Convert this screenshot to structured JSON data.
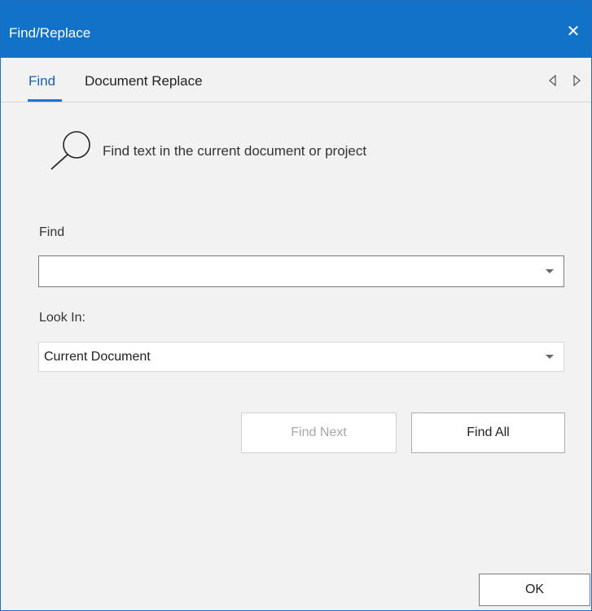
{
  "window": {
    "title": "Find/Replace",
    "close_glyph": "✕",
    "title_bar_color": "#1272c8"
  },
  "tabs": [
    {
      "label": "Find",
      "active": true
    },
    {
      "label": "Document Replace",
      "active": false
    }
  ],
  "tab_nav": {
    "prev_icon": "triangle-left-icon",
    "next_icon": "triangle-right-icon"
  },
  "header": {
    "icon": "magnifier-icon",
    "text": "Find text in the current document or project"
  },
  "find": {
    "label": "Find",
    "value": ""
  },
  "look_in": {
    "label": "Look In:",
    "value": "Current Document"
  },
  "buttons": {
    "find_next": "Find Next",
    "find_next_enabled": false,
    "find_all": "Find All",
    "ok": "OK"
  },
  "accent_color": "#1a73d0"
}
